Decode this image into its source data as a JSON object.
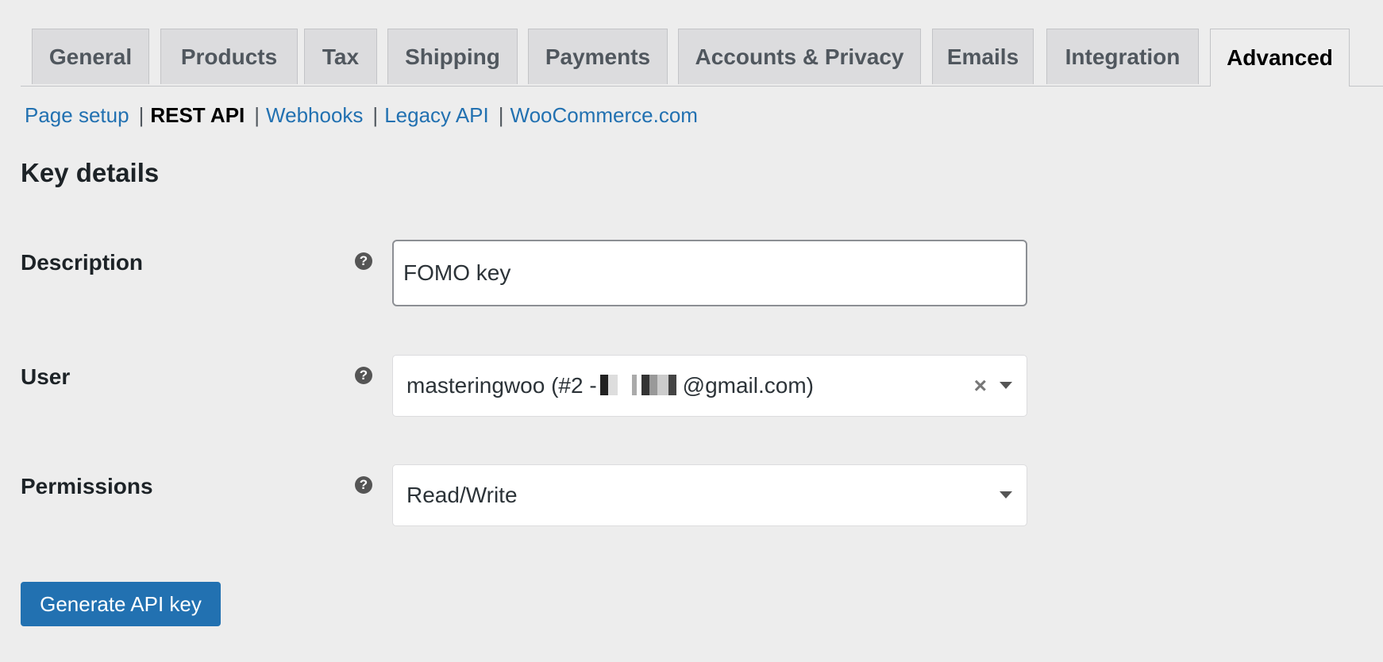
{
  "tabs": [
    {
      "label": "General"
    },
    {
      "label": "Products"
    },
    {
      "label": "Tax"
    },
    {
      "label": "Shipping"
    },
    {
      "label": "Payments"
    },
    {
      "label": "Accounts & Privacy"
    },
    {
      "label": "Emails"
    },
    {
      "label": "Integration"
    },
    {
      "label": "Advanced",
      "active": true
    }
  ],
  "subnav": {
    "page_setup": "Page setup",
    "rest_api": "REST API",
    "webhooks": "Webhooks",
    "legacy_api": "Legacy API",
    "woocommerce": "WooCommerce.com",
    "separator": "|"
  },
  "section": {
    "title": "Key details"
  },
  "form": {
    "description": {
      "label": "Description",
      "value": "FOMO key",
      "help_icon": "question-circle-icon"
    },
    "user": {
      "label": "User",
      "value_prefix": "masteringwoo (#2 -",
      "value_suffix": "@gmail.com)",
      "clear_icon": "×",
      "help_icon": "question-circle-icon"
    },
    "permissions": {
      "label": "Permissions",
      "value": "Read/Write",
      "help_icon": "question-circle-icon"
    },
    "help_glyph": "?"
  },
  "actions": {
    "generate_label": "Generate API key"
  },
  "colors": {
    "accent": "#2271b1",
    "background": "#ededed",
    "tab_bg": "#dcdcde"
  }
}
